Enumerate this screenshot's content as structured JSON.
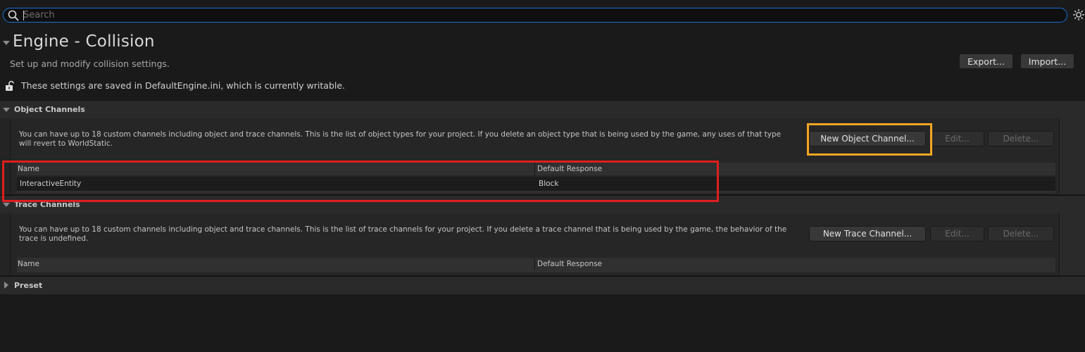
{
  "search": {
    "placeholder": "Search"
  },
  "header": {
    "title": "Engine - Collision",
    "subtitle": "Set up and modify collision settings.",
    "save_note": "These settings are saved in DefaultEngine.ini, which is currently writable.",
    "export_label": "Export...",
    "import_label": "Import..."
  },
  "object_channels": {
    "title": "Object Channels",
    "description": "You can have up to 18 custom channels including object and trace channels. This is the list of object types for your project. If you delete an object type that is being used by the game, any uses of that type will revert to WorldStatic.",
    "new_button": "New Object Channel...",
    "edit_button": "Edit...",
    "delete_button": "Delete...",
    "columns": [
      "Name",
      "Default Response"
    ],
    "rows": [
      {
        "name": "InteractiveEntity",
        "default_response": "Block"
      }
    ]
  },
  "trace_channels": {
    "title": "Trace Channels",
    "description": "You can have up to 18 custom channels including object and trace channels. This is the list of trace channels for your project. If you delete a trace channel that is being used by the game, the behavior of the trace is undefined.",
    "new_button": "New Trace Channel...",
    "edit_button": "Edit...",
    "delete_button": "Delete...",
    "columns": [
      "Name",
      "Default Response"
    ]
  },
  "preset": {
    "title": "Preset"
  },
  "colors": {
    "background": "#1a1a1a",
    "search_border": "#1f6fd6",
    "highlight_orange": "#f5a623",
    "highlight_red": "#e01e1e"
  }
}
